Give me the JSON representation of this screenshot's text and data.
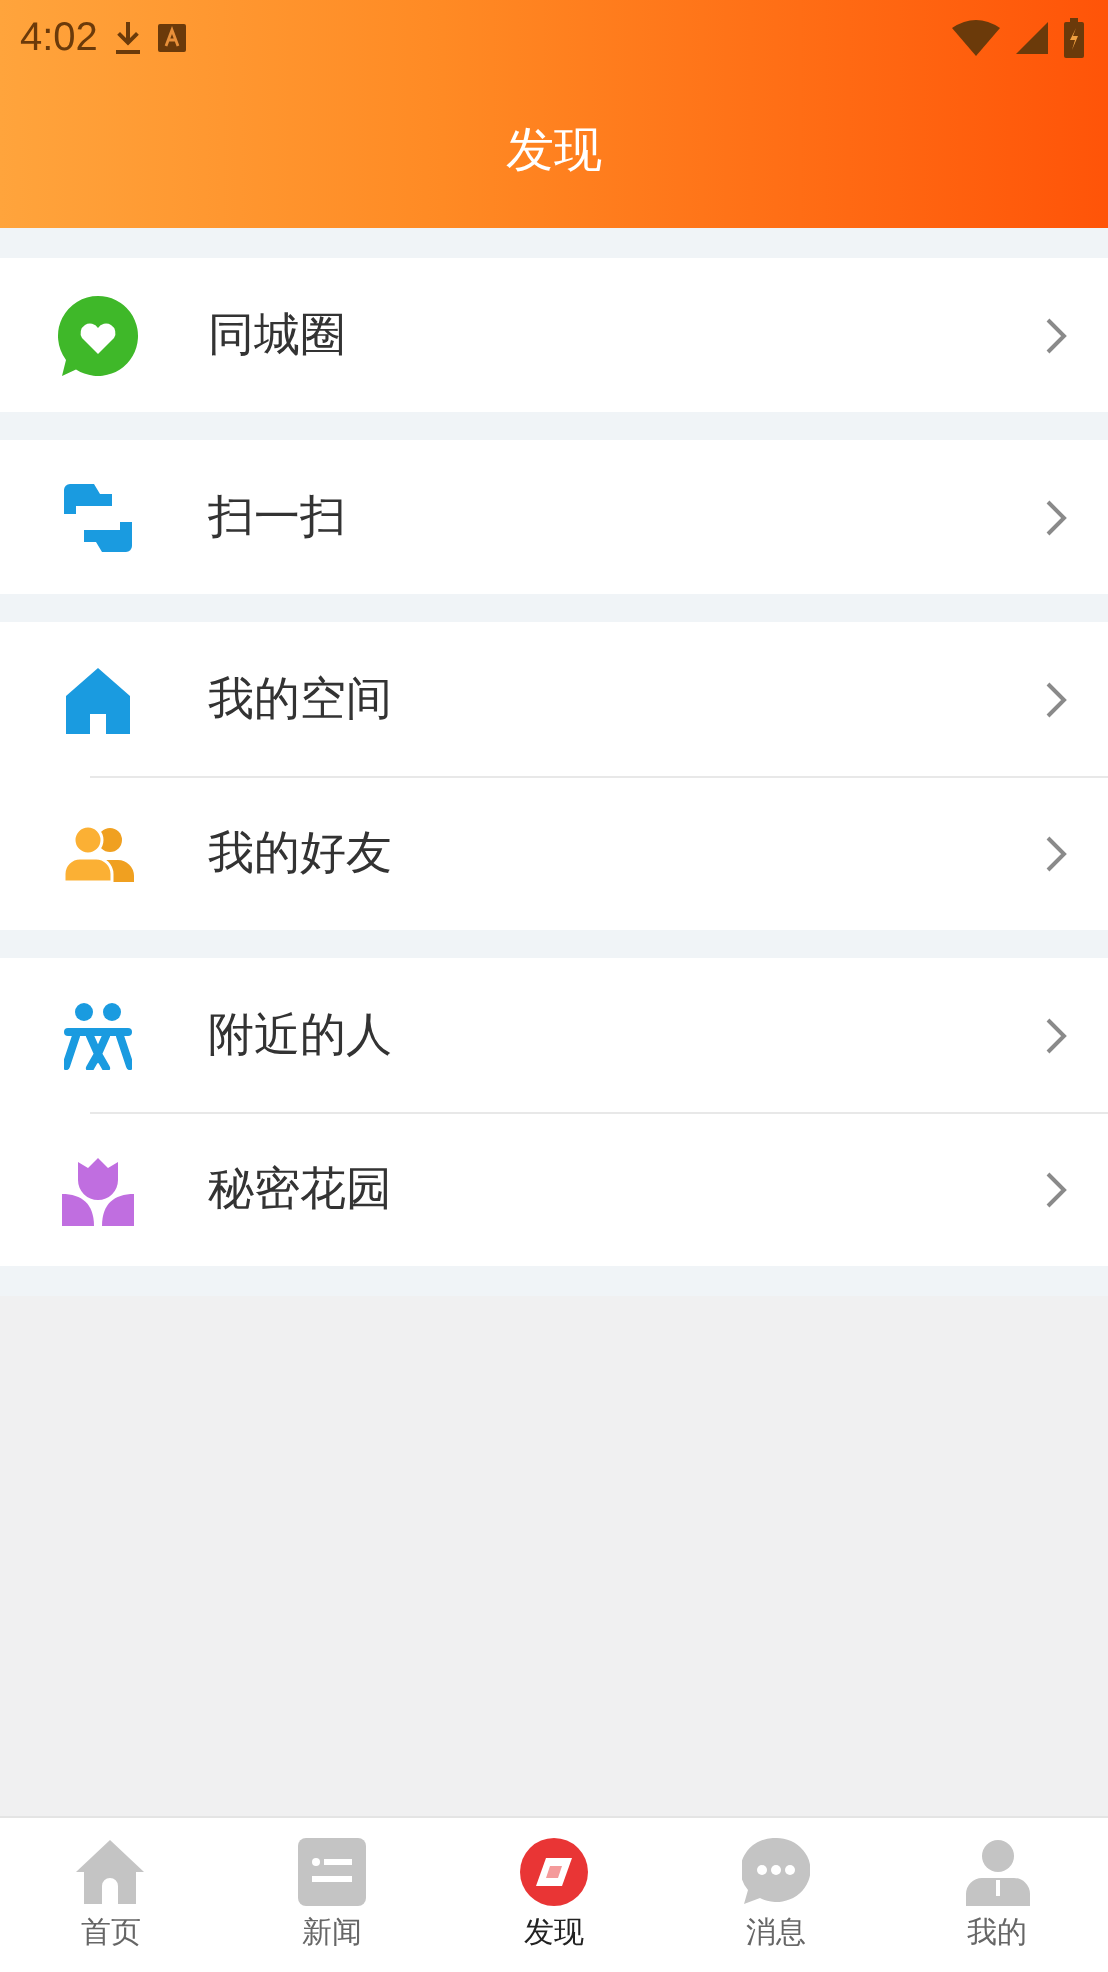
{
  "status_bar": {
    "time": "4:02"
  },
  "title": "发现",
  "groups": [
    {
      "items": [
        {
          "kind": "chat",
          "label": "同城圈"
        }
      ]
    },
    {
      "items": [
        {
          "kind": "scan",
          "label": "扫一扫"
        }
      ]
    },
    {
      "items": [
        {
          "kind": "house",
          "label": "我的空间"
        },
        {
          "kind": "friends",
          "label": "我的好友"
        }
      ]
    },
    {
      "items": [
        {
          "kind": "people",
          "label": "附近的人"
        },
        {
          "kind": "flower",
          "label": "秘密花园"
        }
      ]
    }
  ],
  "tab_bar": [
    {
      "kind": "home",
      "label": "首页",
      "selected": false
    },
    {
      "kind": "news",
      "label": "新闻",
      "selected": false
    },
    {
      "kind": "discover",
      "label": "发现",
      "selected": true
    },
    {
      "kind": "message",
      "label": "消息",
      "selected": false
    },
    {
      "kind": "me",
      "label": "我的",
      "selected": false
    }
  ]
}
